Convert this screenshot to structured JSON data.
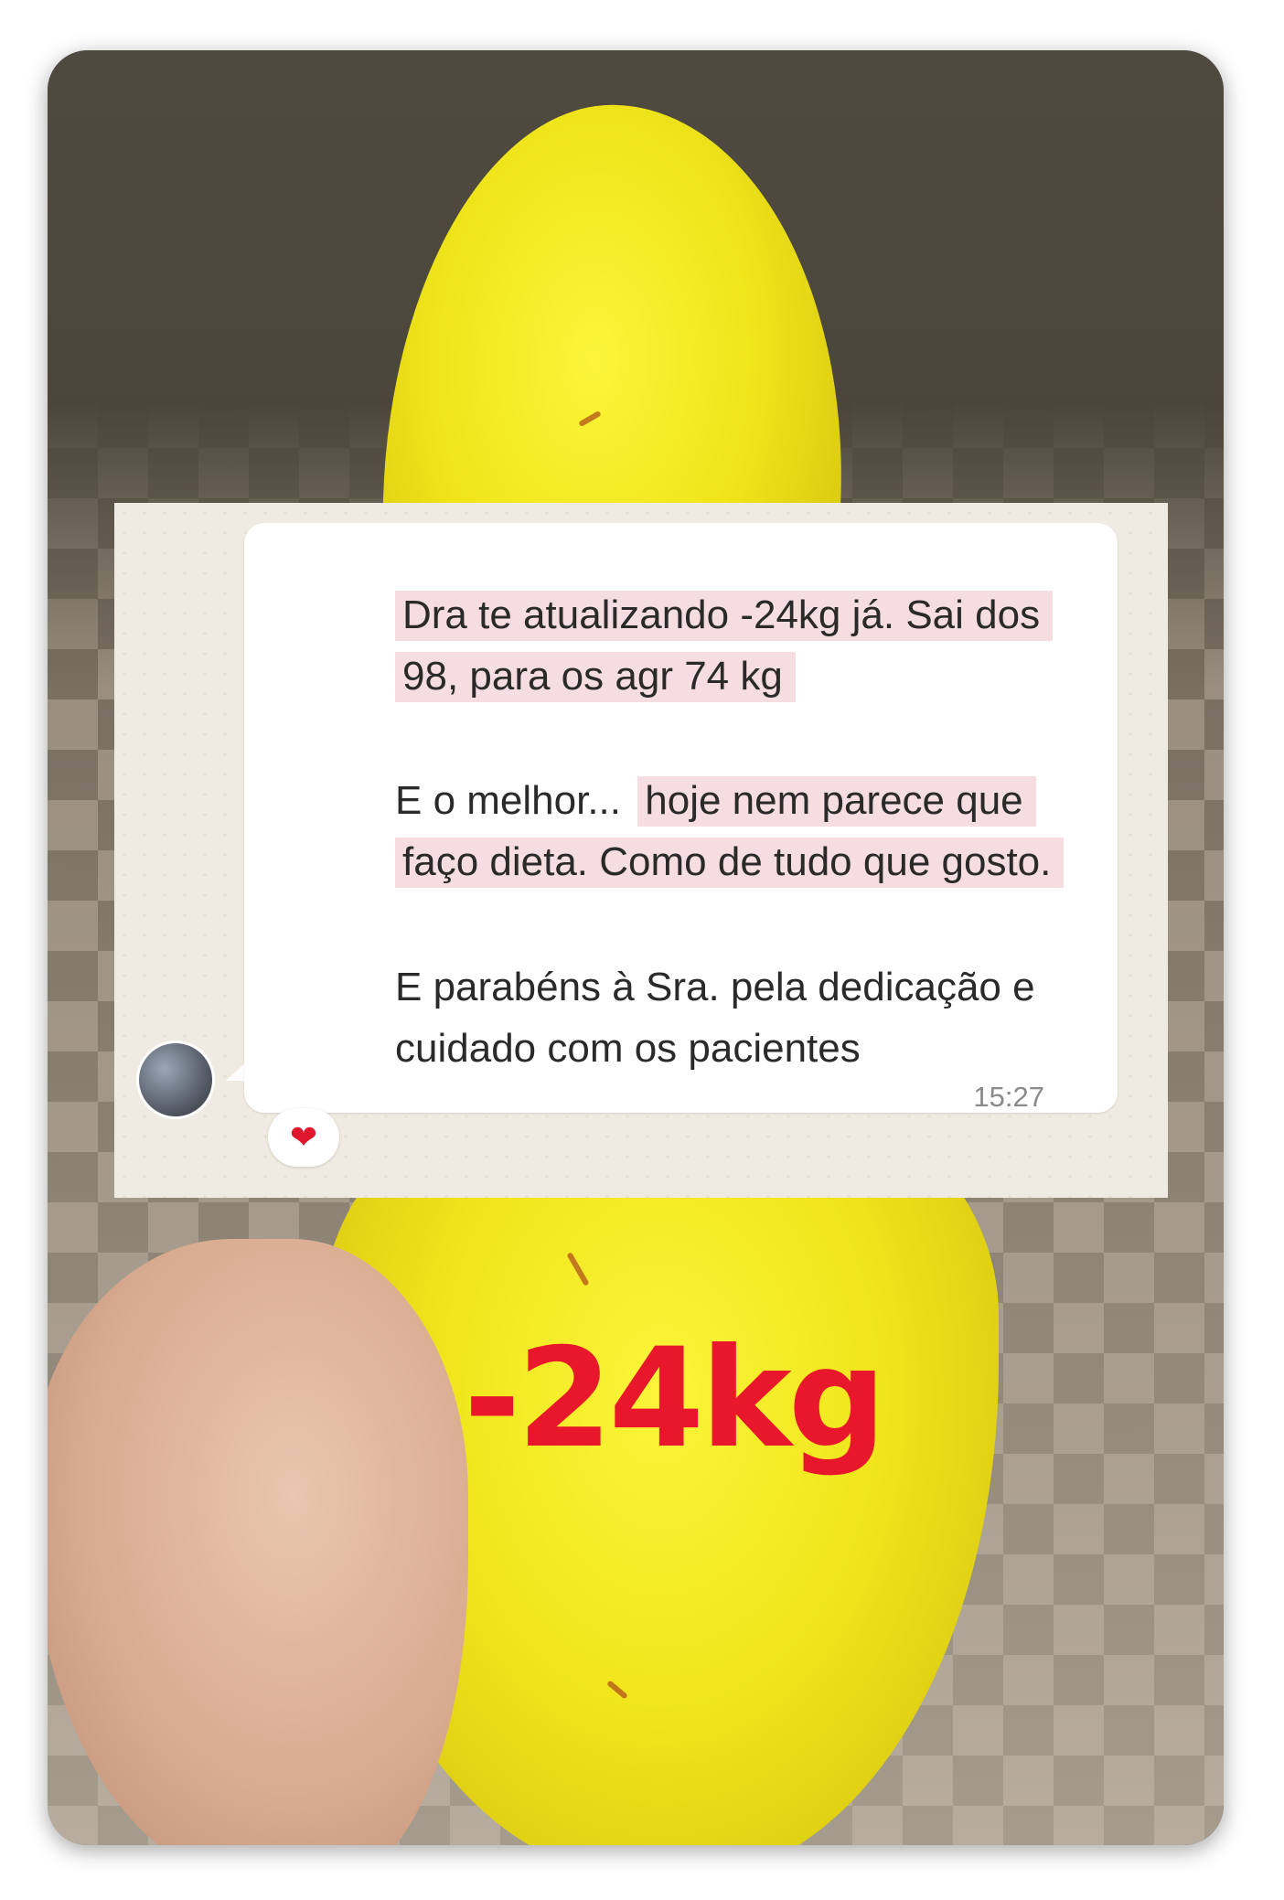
{
  "chat": {
    "message_lines": [
      "Dra te atualizando -24kg já. Sai dos",
      "98, para os agr 74 kg",
      "E o melhor...",
      "hoje nem parece que",
      "faço dieta. Como de tudo que gosto.",
      "E parabéns à Sra. pela dedicação e",
      "cuidado com os pacientes"
    ],
    "time": "15:27",
    "reaction": "❤"
  },
  "overlay": {
    "weight_loss_label": "-24kg"
  },
  "colors": {
    "highlight": "#f5dde1",
    "label_red": "#e8172b",
    "fruit_yellow": "#f0e51a"
  }
}
